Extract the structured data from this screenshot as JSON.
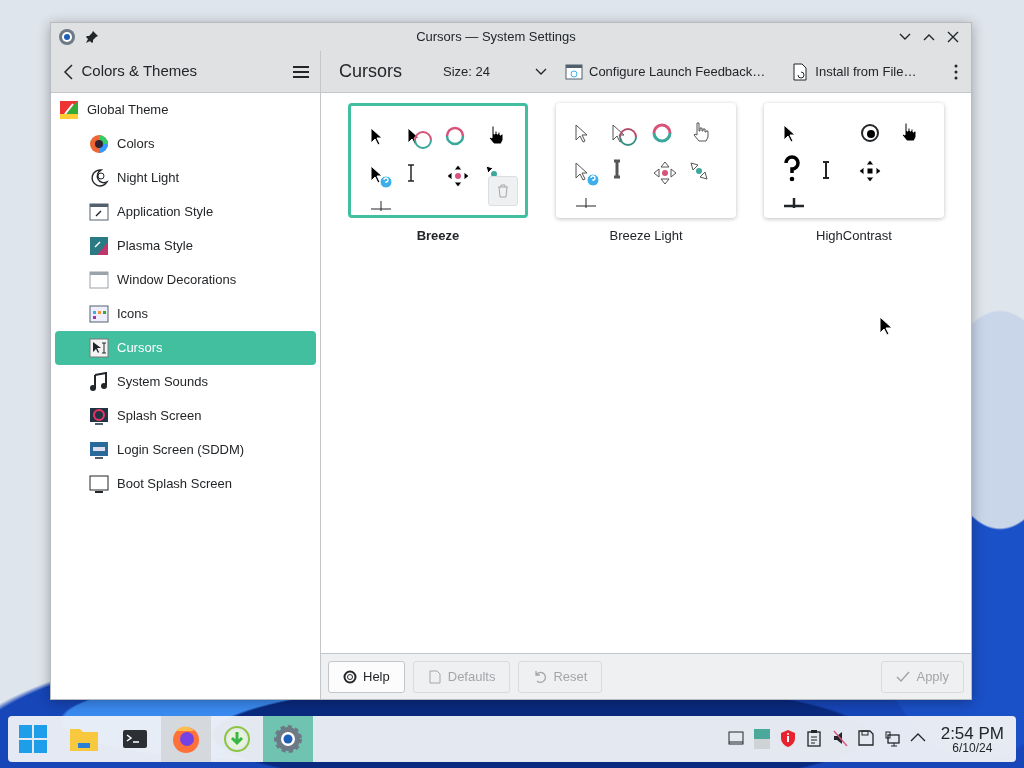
{
  "window": {
    "title": "Cursors — System Settings"
  },
  "sidebar": {
    "back_label": "Colors & Themes",
    "items": [
      {
        "label": "Global Theme",
        "kind": "global",
        "selected": false,
        "children": [
          {
            "label": "Colors",
            "kind": "colors",
            "selected": false
          },
          {
            "label": "Night Light",
            "kind": "night",
            "selected": false
          },
          {
            "label": "Application Style",
            "kind": "appstyle",
            "selected": false
          },
          {
            "label": "Plasma Style",
            "kind": "plasma",
            "selected": false
          },
          {
            "label": "Window Decorations",
            "kind": "windeco",
            "selected": false
          },
          {
            "label": "Icons",
            "kind": "icons",
            "selected": false
          },
          {
            "label": "Cursors",
            "kind": "cursors",
            "selected": true
          },
          {
            "label": "System Sounds",
            "kind": "sounds",
            "selected": false
          },
          {
            "label": "Splash Screen",
            "kind": "splash",
            "selected": false
          },
          {
            "label": "Login Screen (SDDM)",
            "kind": "login",
            "selected": false
          },
          {
            "label": "Boot Splash Screen",
            "kind": "boot",
            "selected": false
          }
        ]
      }
    ]
  },
  "toolbar": {
    "title": "Cursors",
    "size": "Size: 24",
    "actions": [
      {
        "label": "Configure Launch Feedback…",
        "kind": "feedback"
      },
      {
        "label": "Install from File…",
        "kind": "install"
      }
    ]
  },
  "themes": [
    {
      "name": "Breeze",
      "kind": "dark",
      "selected": true
    },
    {
      "name": "Breeze Light",
      "kind": "light",
      "selected": false
    },
    {
      "name": "HighContrast",
      "kind": "contrast",
      "selected": false
    }
  ],
  "footer": {
    "buttons": [
      {
        "label": "Help",
        "kind": "help",
        "disabled": false
      },
      {
        "label": "Defaults",
        "kind": "defaults",
        "disabled": true
      },
      {
        "label": "Reset",
        "kind": "reset",
        "disabled": true
      },
      {
        "label": "Apply",
        "kind": "apply",
        "disabled": true
      }
    ]
  },
  "taskbar": {
    "apps": [
      {
        "kind": "start",
        "selected": false,
        "hovered": false
      },
      {
        "kind": "files",
        "selected": false,
        "hovered": false
      },
      {
        "kind": "terminal",
        "selected": false,
        "hovered": false
      },
      {
        "kind": "browser",
        "selected": false,
        "hovered": true
      },
      {
        "kind": "download",
        "selected": false,
        "hovered": false
      },
      {
        "kind": "settings",
        "selected": true,
        "hovered": false
      }
    ],
    "tray": [
      {
        "kind": "window"
      },
      {
        "kind": "pager"
      },
      {
        "kind": "shield"
      },
      {
        "kind": "clipboard"
      },
      {
        "kind": "mute"
      },
      {
        "kind": "save"
      },
      {
        "kind": "network"
      },
      {
        "kind": "expand"
      }
    ],
    "clock": {
      "time": "2:54 PM",
      "date": "6/10/24"
    }
  }
}
